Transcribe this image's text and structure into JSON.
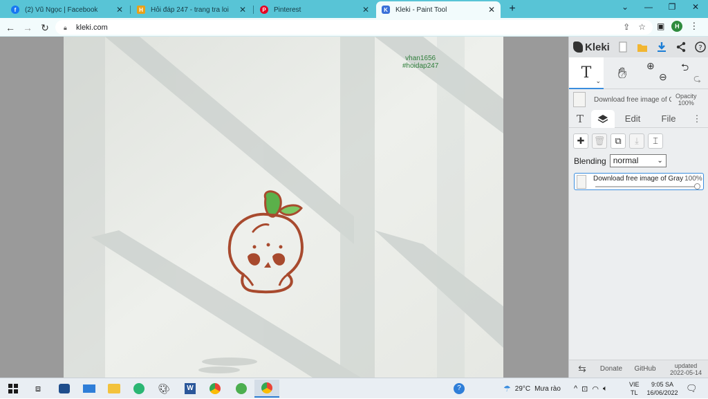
{
  "browser": {
    "tabs": [
      {
        "title": "(2) Vũ Ngọc | Facebook",
        "icon": "facebook-icon",
        "color": "#1877f2"
      },
      {
        "title": "Hỏi đáp 247 - trang tra loi",
        "icon": "hoidap-icon",
        "color": "#e8a21a"
      },
      {
        "title": "Pinterest",
        "icon": "pinterest-icon",
        "color": "#e60023"
      },
      {
        "title": "Kleki - Paint Tool",
        "icon": "kleki-icon",
        "color": "#3a6fd8"
      }
    ],
    "address": "kleki.com",
    "profile_initial": "H"
  },
  "canvas": {
    "watermark_line1": "vhan1656",
    "watermark_line2": "#hoidap247"
  },
  "kleki": {
    "logo_text": "Kleki",
    "layer_name": "Download free image of Gray",
    "opacity_label": "Opacity",
    "opacity_value": "100%",
    "tabs": [
      "Edit",
      "File"
    ],
    "blending_label": "Blending",
    "blending_value": "normal",
    "layer_item_name": "Download free image of Gray",
    "layer_item_opacity": "100%",
    "layer_opacity": 1.0,
    "footer": {
      "donate": "Donate",
      "github": "GitHub",
      "updated_label": "updated",
      "updated_date": "2022-05-14"
    }
  },
  "taskbar": {
    "weather_temp": "29°C",
    "weather_desc": "Mưa rào",
    "lang_line1": "VIE",
    "lang_line2": "TL",
    "time": "9:05 SA",
    "date": "16/06/2022"
  }
}
